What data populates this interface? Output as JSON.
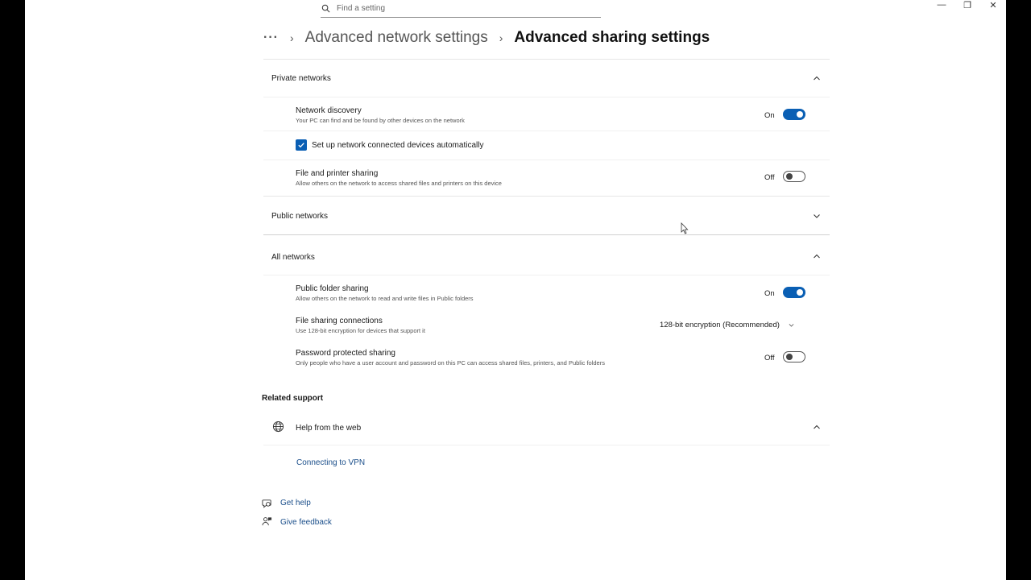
{
  "window_controls": {
    "minimize": "—",
    "maximize": "❐",
    "close": "✕"
  },
  "search": {
    "placeholder": "Find a setting"
  },
  "breadcrumb": {
    "more": "···",
    "parent": "Advanced network settings",
    "current": "Advanced sharing settings"
  },
  "sections": {
    "private": {
      "title": "Private networks",
      "network_discovery": {
        "title": "Network discovery",
        "desc": "Your PC can find and be found by other devices on the network",
        "state": "On"
      },
      "auto_setup": {
        "label": "Set up network connected devices automatically",
        "checked": true
      },
      "file_printer": {
        "title": "File and printer sharing",
        "desc": "Allow others on the network to access shared files and printers on this device",
        "state": "Off"
      }
    },
    "public": {
      "title": "Public networks"
    },
    "all": {
      "title": "All networks",
      "public_folder": {
        "title": "Public folder sharing",
        "desc": "Allow others on the network to read and write files in Public folders",
        "state": "On"
      },
      "file_connections": {
        "title": "File sharing connections",
        "desc": "Use 128-bit encryption for devices that support it",
        "value": "128-bit encryption (Recommended)"
      },
      "password": {
        "title": "Password protected sharing",
        "desc": "Only people who have a user account and password on this PC can access shared files, printers, and Public folders",
        "state": "Off"
      }
    }
  },
  "related": {
    "title": "Related support",
    "help_web": {
      "title": "Help from the web",
      "link": "Connecting to VPN"
    }
  },
  "footer": {
    "get_help": "Get help",
    "give_feedback": "Give feedback"
  },
  "colors": {
    "accent": "#0a5fb4",
    "link": "#1a4e8a"
  }
}
